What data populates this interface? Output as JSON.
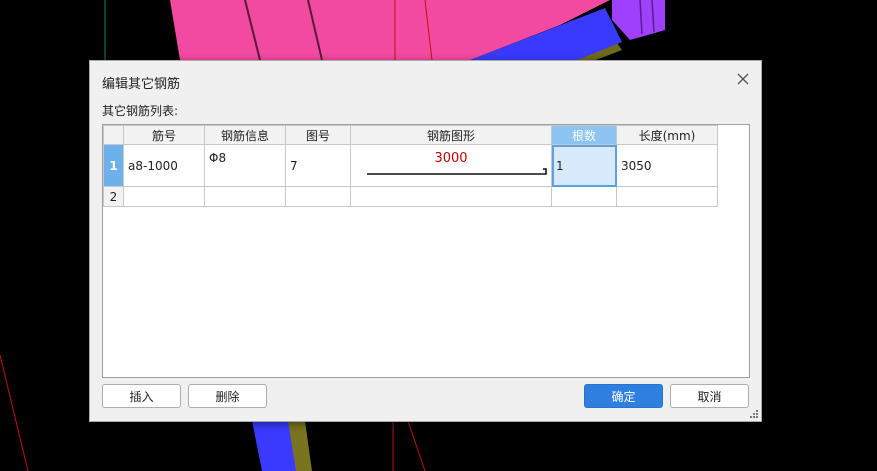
{
  "dialog": {
    "title": "编辑其它钢筋",
    "list_label": "其它钢筋列表:",
    "columns": [
      "筋号",
      "钢筋信息",
      "图号",
      "钢筋图形",
      "根数",
      "长度(mm)"
    ],
    "rows": [
      {
        "index": "1",
        "bar_no": "a8-1000",
        "bar_info": "Φ8",
        "shape_no": "7",
        "shape_value": "3000",
        "count": "1",
        "length": "3050"
      },
      {
        "index": "2",
        "bar_no": "",
        "bar_info": "",
        "shape_no": "",
        "shape_value": "",
        "count": "",
        "length": ""
      }
    ],
    "buttons": {
      "insert": "插入",
      "delete": "删除",
      "confirm": "确定",
      "cancel": "取消"
    }
  },
  "colors": {
    "accent": "#2f7fe0",
    "selected_header": "#8cc4f2",
    "shape_text": "#c00000",
    "cad_magenta": "#f24aa0",
    "cad_blue": "#3838ff",
    "cad_purple": "#a040ff",
    "cad_olive": "#6e6a1c"
  }
}
